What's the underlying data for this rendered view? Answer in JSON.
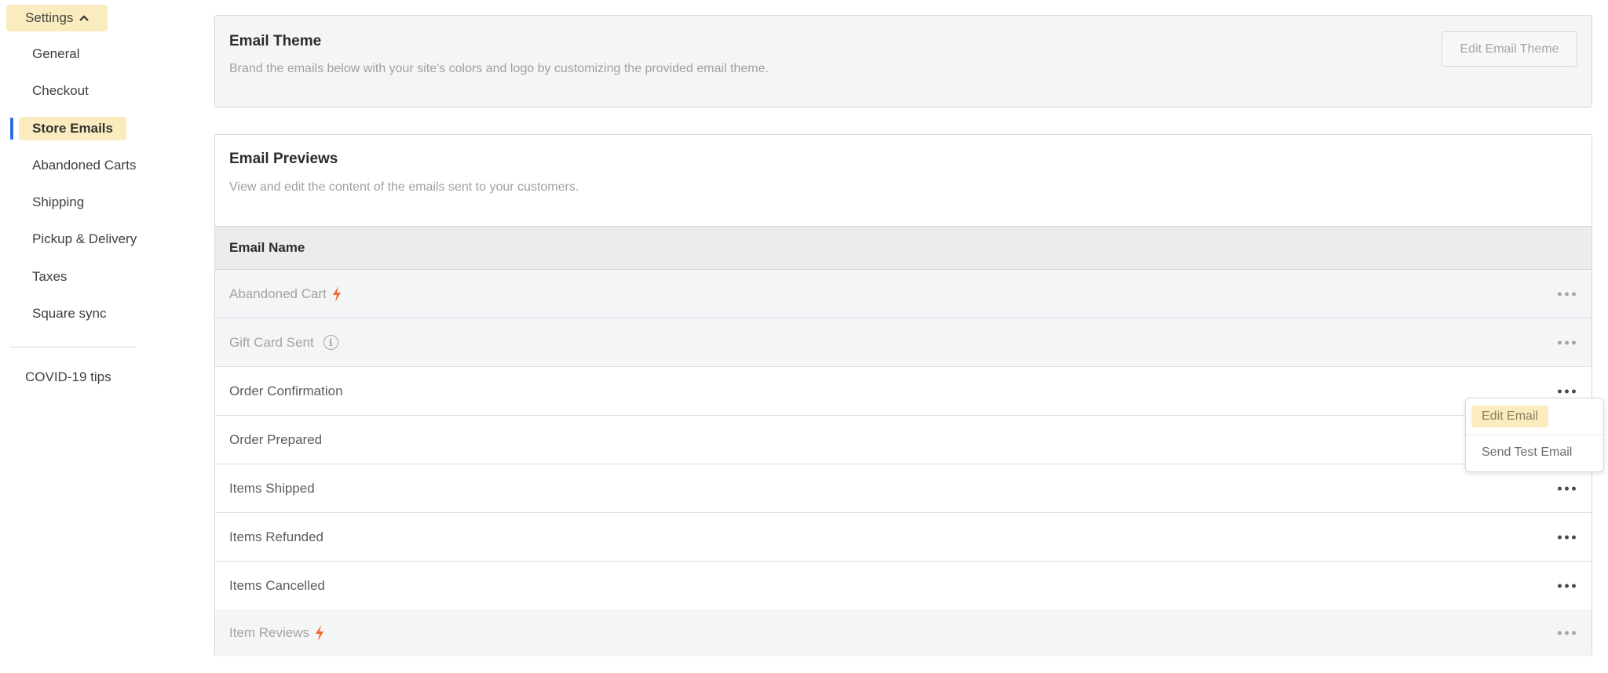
{
  "sidebar": {
    "settings_label": "Settings",
    "items": [
      {
        "label": "General",
        "active": false
      },
      {
        "label": "Checkout",
        "active": false
      },
      {
        "label": "Store Emails",
        "active": true
      },
      {
        "label": "Abandoned Carts",
        "active": false
      },
      {
        "label": "Shipping",
        "active": false
      },
      {
        "label": "Pickup & Delivery",
        "active": false
      },
      {
        "label": "Taxes",
        "active": false
      },
      {
        "label": "Square sync",
        "active": false
      }
    ],
    "extra_link": "COVID-19 tips"
  },
  "theme_card": {
    "title": "Email Theme",
    "description": "Brand the emails below with your site's colors and logo by customizing the provided email theme.",
    "button_label": "Edit Email Theme"
  },
  "previews_card": {
    "title": "Email Previews",
    "description": "View and edit the content of the emails sent to your customers.",
    "column_header": "Email Name",
    "rows": [
      {
        "name": "Abandoned Cart",
        "disabled": true,
        "icon": "lightning-bolt-icon"
      },
      {
        "name": "Gift Card Sent",
        "disabled": true,
        "icon": "info-icon"
      },
      {
        "name": "Order Confirmation",
        "disabled": false
      },
      {
        "name": "Order Prepared",
        "disabled": false
      },
      {
        "name": "Items Shipped",
        "disabled": false
      },
      {
        "name": "Items Refunded",
        "disabled": false
      },
      {
        "name": "Items Cancelled",
        "disabled": false
      },
      {
        "name": "Item Reviews",
        "disabled": true,
        "icon": "lightning-bolt-icon"
      }
    ]
  },
  "row_menu": {
    "items": [
      "Edit Email",
      "Send Test Email"
    ],
    "highlighted": "Edit Email"
  },
  "colors": {
    "highlight": "#fbecc0",
    "active_bar": "#2f6de1",
    "bolt": "#f26b2b"
  }
}
